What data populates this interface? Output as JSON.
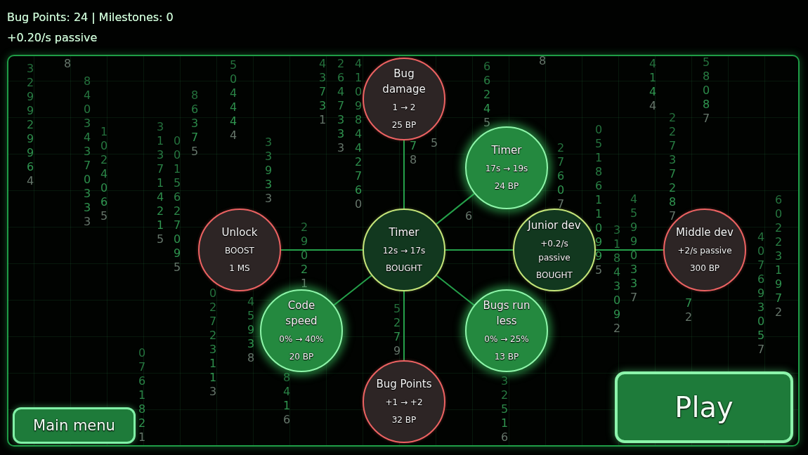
{
  "header": {
    "stats": "Bug Points: 24 | Milestones: 0",
    "passive_rate": "+0.20/s passive"
  },
  "background_digits": [
    "329929964",
    "8",
    "84034370333",
    "1024065",
    "0761821",
    "313714215",
    "0015627095",
    "86375",
    "02723113",
    "504444",
    "45938",
    "33933",
    "8416",
    "29021",
    "43731",
    "2647333",
    "41098442760",
    "5279",
    "78",
    "5",
    "6",
    "66245",
    "32516",
    "8",
    "27607",
    "05186110995",
    "31843092",
    "45990337",
    "4144",
    "22737287",
    "72",
    "58087",
    "407693057",
    "602231972"
  ],
  "skill_tree": {
    "title": "Timer",
    "effect": "12s → 17s",
    "cost": "BOUGHT",
    "bought": true,
    "affordable": false,
    "children": [
      {
        "title": "Bug damage",
        "effect": "1 → 2",
        "cost": "25 BP",
        "bought": false,
        "affordable": false
      },
      {
        "title": "Timer",
        "effect": "17s → 19s",
        "cost": "24 BP",
        "bought": false,
        "affordable": true
      },
      {
        "title": "Unlock",
        "effect": "BOOST",
        "cost": "1 MS",
        "bought": false,
        "affordable": false
      },
      {
        "title": "Junior dev",
        "effect": "+0.2/s passive",
        "cost": "BOUGHT",
        "bought": true,
        "affordable": false,
        "children": [
          {
            "title": "Middle dev",
            "effect": "+2/s passive",
            "cost": "300 BP",
            "bought": false,
            "affordable": false
          }
        ]
      },
      {
        "title": "Code speed",
        "effect": "0% → 40%",
        "cost": "20 BP",
        "bought": false,
        "affordable": true
      },
      {
        "title": "Bugs run less",
        "effect": "0% → 25%",
        "cost": "13 BP",
        "bought": false,
        "affordable": true
      },
      {
        "title": "Bug Points",
        "effect": "+1 → +2",
        "cost": "32 BP",
        "bought": false,
        "affordable": false
      }
    ]
  },
  "main_menu_button": {
    "label": "Main menu"
  },
  "play_button": {
    "label": "Play"
  }
}
